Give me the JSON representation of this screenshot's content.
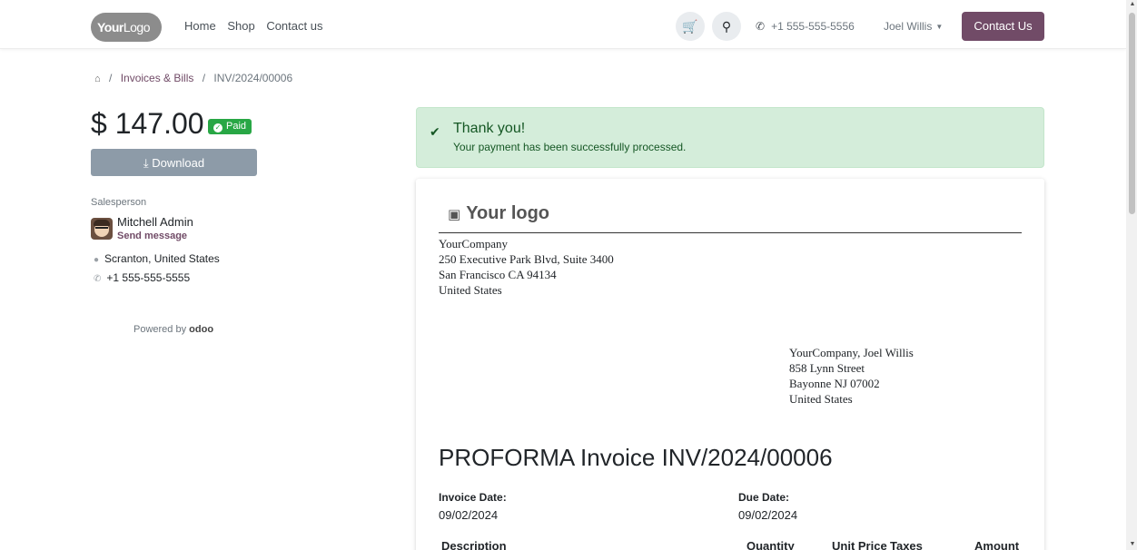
{
  "header": {
    "logo_bold": "Your",
    "logo_thin": "Logo",
    "nav": [
      "Home",
      "Shop",
      "Contact us"
    ],
    "cart_icon": "cart-icon",
    "search_icon": "search-icon",
    "phone_icon": "phone-icon",
    "phone": "+1 555-555-5556",
    "user": "Joel Willis",
    "contact_button": "Contact Us",
    "brand_color": "#714b67"
  },
  "breadcrumb": {
    "home_icon": "home-icon",
    "sep": "/",
    "items": [
      "Invoices & Bills",
      "INV/2024/00006"
    ]
  },
  "sidebar": {
    "amount": "$ 147.00",
    "badge": "Paid",
    "badge_color": "#28a745",
    "download": "Download",
    "salesperson_label": "Salesperson",
    "salesperson_name": "Mitchell Admin",
    "send_message": "Send message",
    "location": "Scranton, United States",
    "phone": "+1 555-555-5555",
    "powered_by": "Powered by",
    "powered_brand": "odoo"
  },
  "alert": {
    "title": "Thank you!",
    "body": "Your payment has been successfully processed.",
    "color": "#d4edda"
  },
  "invoice": {
    "logo_text": "Your logo",
    "company": [
      "YourCompany",
      "250 Executive Park Blvd, Suite 3400",
      "San Francisco CA 94134",
      "United States"
    ],
    "partner": [
      "YourCompany, Joel Willis",
      "858 Lynn Street",
      "Bayonne NJ 07002",
      "United States"
    ],
    "title": "PROFORMA Invoice INV/2024/00006",
    "invoice_date_label": "Invoice Date:",
    "invoice_date": "09/02/2024",
    "due_date_label": "Due Date:",
    "due_date": "09/02/2024",
    "columns": [
      "Description",
      "Quantity",
      "Unit Price",
      "Taxes",
      "Amount"
    ]
  }
}
